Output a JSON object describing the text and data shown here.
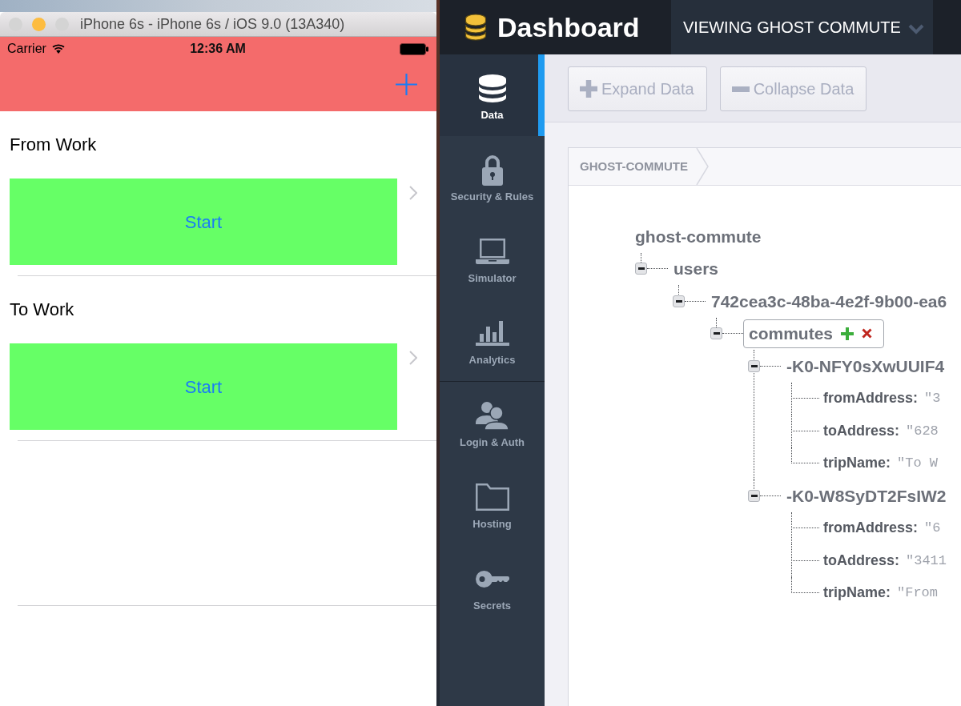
{
  "simulator": {
    "title": "iPhone 6s - iPhone 6s / iOS 9.0 (13A340)",
    "window_buttons": [
      {
        "color": "#d4d4d4"
      },
      {
        "color": "#fdbc40"
      },
      {
        "color": "#d4d4d4"
      }
    ]
  },
  "phone": {
    "status_bar": {
      "carrier": "Carrier",
      "time": "12:36 AM"
    },
    "trips": [
      {
        "title": "From Work",
        "button": "Start"
      },
      {
        "title": "To Work",
        "button": "Start"
      }
    ]
  },
  "dashboard": {
    "title": "Dashboard",
    "app_selector": "VIEWING GHOST COMMUTE",
    "sidebar": {
      "groups": [
        [
          {
            "kind": "database",
            "label": "Data",
            "selected": true
          },
          {
            "kind": "lock",
            "label": "Security & Rules",
            "selected": false
          },
          {
            "kind": "laptop",
            "label": "Simulator",
            "selected": false
          },
          {
            "kind": "chart",
            "label": "Analytics",
            "selected": false
          }
        ],
        [
          {
            "kind": "users",
            "label": "Login & Auth",
            "selected": false
          },
          {
            "kind": "folder",
            "label": "Hosting",
            "selected": false
          },
          {
            "kind": "key",
            "label": "Secrets",
            "selected": false
          }
        ]
      ]
    },
    "toolbar": [
      {
        "kind": "expand",
        "label": "Expand Data"
      },
      {
        "kind": "collapse",
        "label": "Collapse Data"
      }
    ],
    "breadcrumb": [
      "GHOST-COMMUTE"
    ],
    "tree": {
      "label": "ghost-commute",
      "children": [
        {
          "kind": "branch",
          "label": "users",
          "expanded": true,
          "highlighted": false,
          "children": [
            {
              "kind": "branch",
              "label": "742cea3c-48ba-4e2f-9b00-ea6",
              "expanded": true,
              "highlighted": false,
              "children": [
                {
                  "kind": "branch",
                  "label": "commutes",
                  "expanded": true,
                  "highlighted": true,
                  "children": [
                    {
                      "kind": "branch",
                      "label": "-K0-NFY0sXwUUIF4",
                      "expanded": true,
                      "highlighted": false,
                      "children": [
                        {
                          "kind": "leaf",
                          "label": "fromAddress:",
                          "value": "\"3"
                        },
                        {
                          "kind": "leaf",
                          "label": "toAddress:",
                          "value": "\"628"
                        },
                        {
                          "kind": "leaf",
                          "label": "tripName:",
                          "value": "\"To W"
                        }
                      ]
                    },
                    {
                      "kind": "branch",
                      "label": "-K0-W8SyDT2FsIW2",
                      "expanded": true,
                      "highlighted": false,
                      "children": [
                        {
                          "kind": "leaf",
                          "label": "fromAddress:",
                          "value": "\"6"
                        },
                        {
                          "kind": "leaf",
                          "label": "toAddress:",
                          "value": "\"3411"
                        },
                        {
                          "kind": "leaf",
                          "label": "tripName:",
                          "value": "\"From"
                        }
                      ]
                    }
                  ]
                }
              ]
            }
          ]
        }
      ]
    }
  }
}
